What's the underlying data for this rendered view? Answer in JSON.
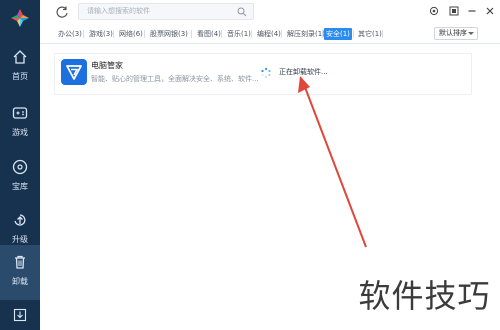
{
  "sidebar": {
    "items": [
      {
        "label": "首页",
        "icon": "home-icon"
      },
      {
        "label": "游戏",
        "icon": "gamepad-icon"
      },
      {
        "label": "宝库",
        "icon": "disc-icon"
      },
      {
        "label": "升级",
        "icon": "upgrade-icon"
      },
      {
        "label": "卸载",
        "icon": "trash-icon"
      }
    ],
    "active": "卸载"
  },
  "search": {
    "placeholder": "请输入想搜索的软件"
  },
  "tabs": [
    {
      "label": "办公(3)"
    },
    {
      "label": "游戏(3)"
    },
    {
      "label": "网络(6)"
    },
    {
      "label": "股票网银(3)"
    },
    {
      "label": "看图(4)"
    },
    {
      "label": "音乐(1)"
    },
    {
      "label": "编程(4)"
    },
    {
      "label": "解压刻录(1)"
    },
    {
      "label": "安全(1)",
      "active": true
    },
    {
      "label": "其它(1)"
    }
  ],
  "sort": {
    "label": "默认排序"
  },
  "card": {
    "name": "电脑管家",
    "description": "智能、贴心的管理工具，全面解决安全、系统、软件...",
    "status": "正在卸载软件..."
  },
  "watermark": {
    "text": "软件技巧"
  },
  "colors": {
    "sidebar": "#17324f",
    "accent": "#2b8cf0",
    "arrow": "#e0463a"
  }
}
